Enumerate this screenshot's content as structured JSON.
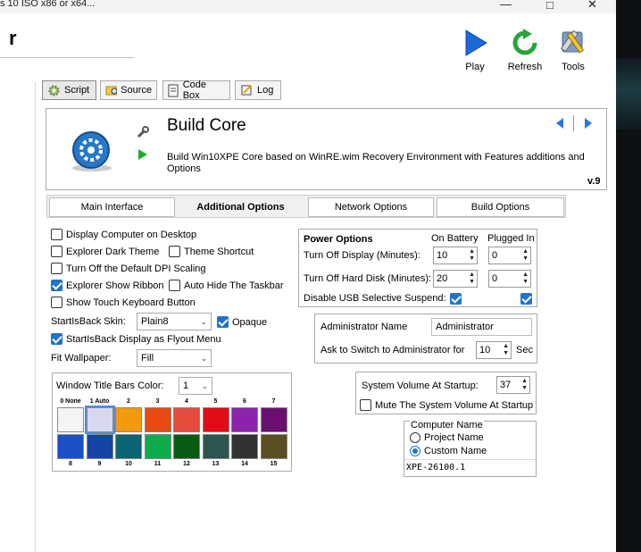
{
  "window": {
    "title": "s 10 ISO x86 or x64...",
    "minimize_icon": "minimize-icon",
    "maximize_icon": "maximize-icon",
    "close_icon": "close-icon"
  },
  "app": {
    "title": "r"
  },
  "toolbar": {
    "play": "Play",
    "refresh": "Refresh",
    "tools": "Tools"
  },
  "tabs": [
    {
      "label": "Script",
      "icon": "gear-icon"
    },
    {
      "label": "Source",
      "icon": "folder-search-icon"
    },
    {
      "label": "Code Box",
      "icon": "document-icon"
    },
    {
      "label": "Log",
      "icon": "log-icon"
    }
  ],
  "script": {
    "title": "Build Core",
    "description": "Build Win10XPE Core based on WinRE.wim Recovery Environment with Features additions and Options",
    "version": "v.9"
  },
  "section_tabs": [
    "Main Interface",
    "Additional Options",
    "Network Options",
    "Build Options"
  ],
  "options": {
    "display_computer": "Display Computer on Desktop",
    "explorer_dark": "Explorer Dark Theme",
    "theme_shortcut": "Theme Shortcut",
    "turn_off_dpi": "Turn Off the Default DPI Scaling",
    "explorer_ribbon": "Explorer Show Ribbon",
    "auto_hide": "Auto Hide The Taskbar",
    "touch_keyboard": "Show Touch Keyboard Button",
    "skin_label": "StartIsBack Skin:",
    "skin_value": "Plain8",
    "opaque": "Opaque",
    "flyout": "StartIsBack Display as Flyout Menu",
    "wallpaper_label": "Fit Wallpaper:",
    "wallpaper_value": "Fill"
  },
  "title_bars": {
    "label": "Window Title Bars Color:",
    "value": "1",
    "top_numbers": [
      "0 None",
      "1 Auto",
      "2",
      "3",
      "4",
      "5",
      "6",
      "7"
    ],
    "bottom_numbers": [
      "8",
      "9",
      "10",
      "11",
      "12",
      "13",
      "14",
      "15"
    ],
    "top_colors": [
      "#f4f4f4",
      "#d8d8f0",
      "#f39a0c",
      "#e84a12",
      "#e54a3c",
      "#e10c16",
      "#8d22ab",
      "#6b0f6e"
    ],
    "bottom_colors": [
      "#1c4ec4",
      "#1343a3",
      "#0b6472",
      "#0eac4c",
      "#075c12",
      "#2c5550",
      "#323232",
      "#5a4f22"
    ]
  },
  "power": {
    "title": "Power Options",
    "on_battery": "On Battery",
    "plugged_in": "Plugged In",
    "display_label": "Turn Off Display (Minutes):",
    "display_battery": "10",
    "display_plugged": "0",
    "disk_label": "Turn Off Hard Disk (Minutes):",
    "disk_battery": "20",
    "disk_plugged": "0",
    "usb_label": "Disable USB Selective Suspend:"
  },
  "admin": {
    "name_label": "Administrator Name",
    "name_value": "Administrator",
    "switch_label": "Ask to Switch to Administrator for",
    "switch_value": "10",
    "unit": "Sec"
  },
  "volume": {
    "label": "System Volume At Startup:",
    "value": "37",
    "mute": "Mute The System Volume At Startup"
  },
  "computer": {
    "title": "Computer Name",
    "project": "Project Name",
    "custom": "Custom Name",
    "value": "XPE-26100.1"
  }
}
